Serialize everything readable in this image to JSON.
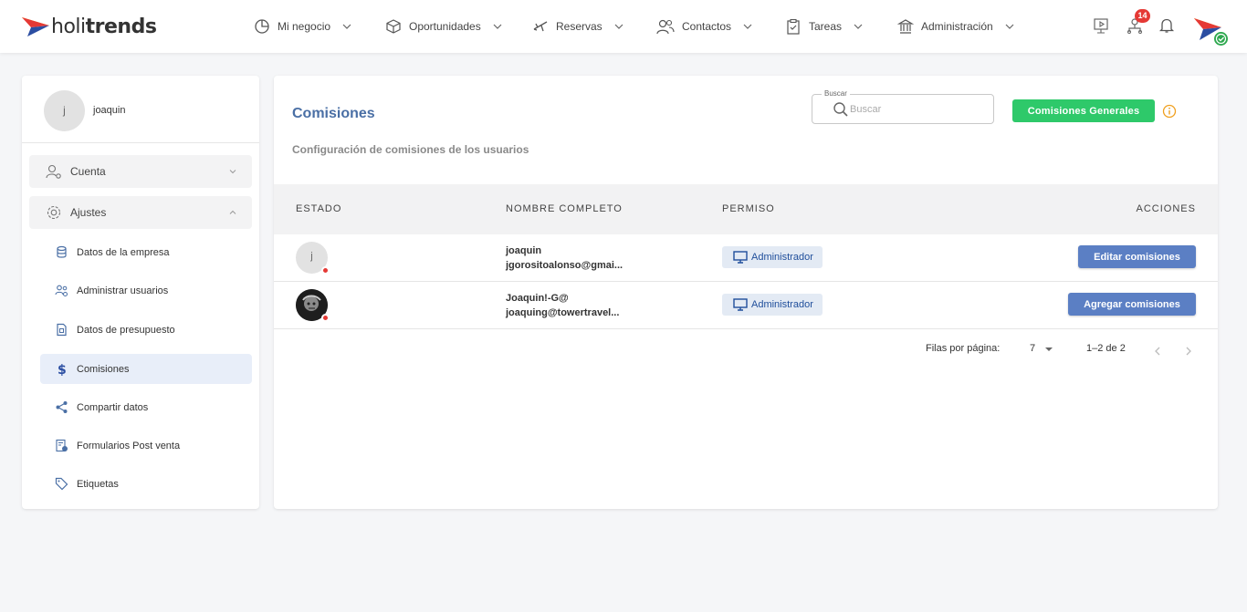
{
  "brand": {
    "name_light": "holi",
    "name_bold": "trends"
  },
  "nav": {
    "items": [
      {
        "label": "Mi negocio",
        "icon": "pie-chart-icon"
      },
      {
        "label": "Oportunidades",
        "icon": "box-icon"
      },
      {
        "label": "Reservas",
        "icon": "plane-icon"
      },
      {
        "label": "Contactos",
        "icon": "users-icon"
      },
      {
        "label": "Tareas",
        "icon": "clipboard-icon"
      },
      {
        "label": "Administración",
        "icon": "bank-icon"
      }
    ],
    "notification_count": "14"
  },
  "sidebar": {
    "user": {
      "initial": "j",
      "name": "joaquin"
    },
    "groups": [
      {
        "label": "Cuenta",
        "expanded": false
      },
      {
        "label": "Ajustes",
        "expanded": true
      }
    ],
    "items": [
      {
        "label": "Datos de la empresa",
        "icon": "database-icon"
      },
      {
        "label": "Administrar usuarios",
        "icon": "manage-users-icon"
      },
      {
        "label": "Datos de presupuesto",
        "icon": "document-icon"
      },
      {
        "label": "Comisiones",
        "icon": "dollar-icon",
        "active": true
      },
      {
        "label": "Compartir datos",
        "icon": "share-icon"
      },
      {
        "label": "Formularios Post venta",
        "icon": "form-icon"
      },
      {
        "label": "Etiquetas",
        "icon": "tag-icon"
      }
    ]
  },
  "main": {
    "title": "Comisiones",
    "subtitle": "Configuración de comisiones de los usuarios",
    "search": {
      "label": "Buscar",
      "placeholder": "Buscar"
    },
    "general_button": "Comisiones Generales",
    "columns": [
      "ESTADO",
      "NOMBRE COMPLETO",
      "PERMISO",
      "ACCIONES"
    ],
    "rows": [
      {
        "initial": "j",
        "name": "joaquin",
        "email": "jgorositoalonso@gmai...",
        "permission": "Administrador",
        "action": "Editar comisiones"
      },
      {
        "initial": "",
        "name": "Joaquin!-G@",
        "email": "joaquing@towertravel...",
        "permission": "Administrador",
        "action": "Agregar comisiones"
      }
    ],
    "pagination": {
      "rows_label": "Filas por página:",
      "rows_per_page": "7",
      "range": "1–2 de 2"
    }
  },
  "colors": {
    "accent": "#4a6fa5",
    "green": "#2ec96a",
    "button_blue": "#5b7fc4",
    "badge_red": "#e53935"
  }
}
